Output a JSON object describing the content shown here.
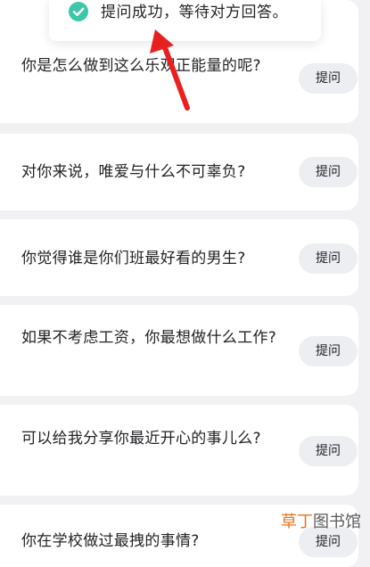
{
  "toast": {
    "icon": "check-circle-icon",
    "message": "提问成功，等待对方回答。",
    "accent_color": "#3dc7a8"
  },
  "annotation": {
    "icon": "red-arrow-icon",
    "color": "#e82020"
  },
  "questions": [
    {
      "text": "你是怎么做到这么乐观正能量的呢?",
      "button_label": "提问"
    },
    {
      "text": "对你来说，唯爱与什么不可辜负?",
      "button_label": "提问"
    },
    {
      "text": "你觉得谁是你们班最好看的男生?",
      "button_label": "提问"
    },
    {
      "text": "如果不考虑工资，你最想做什么工作?",
      "button_label": "提问"
    },
    {
      "text": "可以给我分享你最近开心的事儿么?",
      "button_label": "提问"
    },
    {
      "text": "你在学校做过最拽的事情?",
      "button_label": "提问"
    }
  ],
  "watermark": {
    "brand": "草丁",
    "rest": "图书馆",
    "brand_color": "#e9731f"
  }
}
